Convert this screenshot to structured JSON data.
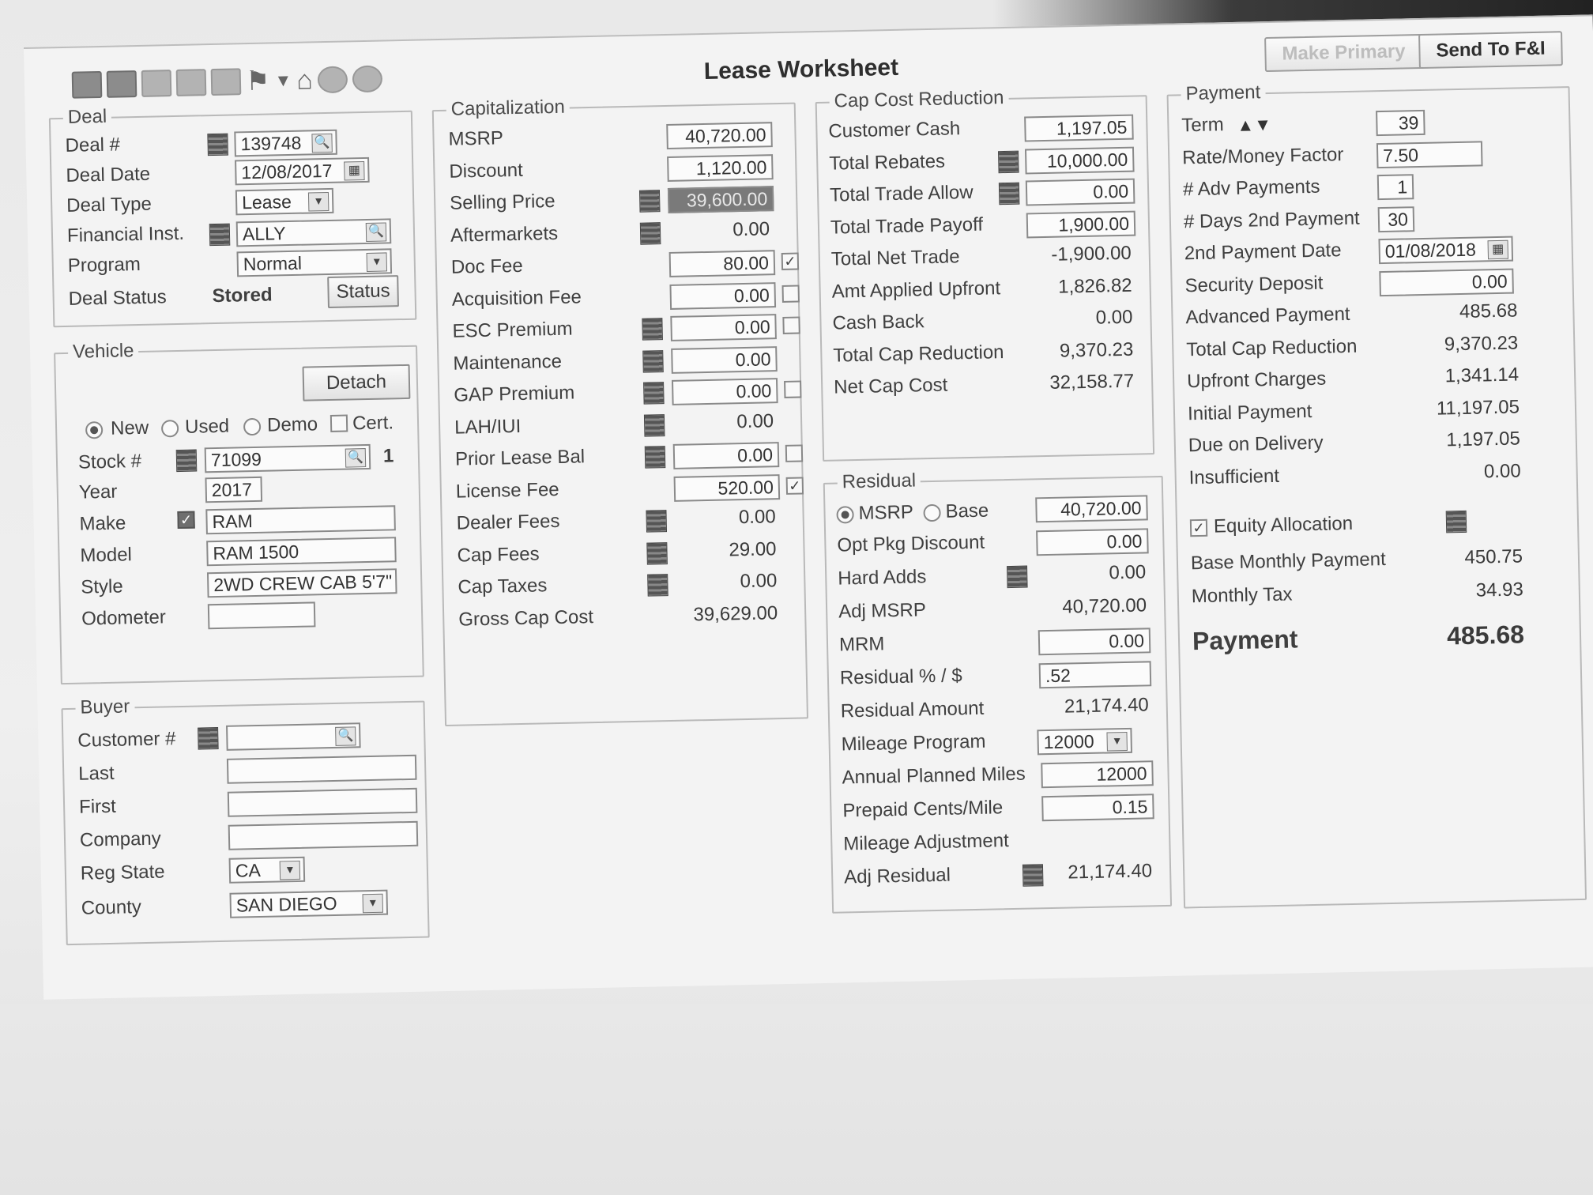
{
  "window": {
    "title": "Lease Worksheet",
    "make_primary": "Make Primary",
    "send_to_fi": "Send To F&I"
  },
  "deal": {
    "legend": "Deal",
    "deal_no_label": "Deal #",
    "deal_no": "139748",
    "deal_date_label": "Deal Date",
    "deal_date": "12/08/2017",
    "deal_type_label": "Deal Type",
    "deal_type": "Lease",
    "financial_label": "Financial Inst.",
    "financial": "ALLY",
    "program_label": "Program",
    "program": "Normal",
    "status_label": "Deal Status",
    "status": "Stored",
    "status_button": "Status"
  },
  "vehicle": {
    "legend": "Vehicle",
    "detach": "Detach",
    "new": "New",
    "used": "Used",
    "demo": "Demo",
    "cert": "Cert.",
    "stock_label": "Stock #",
    "stock": "71099",
    "stock_count": "1",
    "year_label": "Year",
    "year": "2017",
    "make_label": "Make",
    "make": "RAM",
    "model_label": "Model",
    "model": "RAM 1500",
    "style_label": "Style",
    "style": "2WD CREW CAB 5'7\"",
    "odometer_label": "Odometer",
    "odometer": ""
  },
  "buyer": {
    "legend": "Buyer",
    "customer_label": "Customer #",
    "last_label": "Last",
    "first_label": "First",
    "company_label": "Company",
    "reg_state_label": "Reg State",
    "reg_state": "CA",
    "county_label": "County",
    "county": "SAN DIEGO"
  },
  "capitalization": {
    "legend": "Capitalization",
    "rows": [
      {
        "label": "MSRP",
        "value": "40,720.00"
      },
      {
        "label": "Discount",
        "value": "1,120.00"
      },
      {
        "label": "Selling Price",
        "value": "39,600.00"
      },
      {
        "label": "Aftermarkets",
        "value": "0.00"
      },
      {
        "label": "Doc Fee",
        "value": "80.00"
      },
      {
        "label": "Acquisition Fee",
        "value": "0.00"
      },
      {
        "label": "ESC Premium",
        "value": "0.00"
      },
      {
        "label": "Maintenance",
        "value": "0.00"
      },
      {
        "label": "GAP Premium",
        "value": "0.00"
      },
      {
        "label": "LAH/IUI",
        "value": "0.00"
      },
      {
        "label": "Prior Lease Bal",
        "value": "0.00"
      },
      {
        "label": "License Fee",
        "value": "520.00"
      },
      {
        "label": "Dealer Fees",
        "value": "0.00"
      },
      {
        "label": "Cap Fees",
        "value": "29.00"
      },
      {
        "label": "Cap Taxes",
        "value": "0.00"
      },
      {
        "label": "Gross Cap Cost",
        "value": "39,629.00"
      }
    ]
  },
  "cap_reduction": {
    "legend": "Cap Cost Reduction",
    "rows": [
      {
        "label": "Customer Cash",
        "value": "1,197.05"
      },
      {
        "label": "Total Rebates",
        "value": "10,000.00"
      },
      {
        "label": "Total Trade Allow",
        "value": "0.00"
      },
      {
        "label": "Total Trade Payoff",
        "value": "1,900.00"
      },
      {
        "label": "Total Net Trade",
        "value": "-1,900.00"
      },
      {
        "label": "Amt Applied Upfront",
        "value": "1,826.82"
      },
      {
        "label": "Cash Back",
        "value": "0.00"
      },
      {
        "label": "Total Cap Reduction",
        "value": "9,370.23"
      },
      {
        "label": "Net Cap Cost",
        "value": "32,158.77"
      }
    ]
  },
  "residual": {
    "legend": "Residual",
    "msrp_radio": "MSRP",
    "base_radio": "Base",
    "base_value": "40,720.00",
    "rows": [
      {
        "label": "Opt Pkg Discount",
        "value": "0.00"
      },
      {
        "label": "Hard Adds",
        "value": "0.00"
      },
      {
        "label": "Adj MSRP",
        "value": "40,720.00"
      },
      {
        "label": "MRM",
        "value": "0.00"
      },
      {
        "label": "Residual % / $",
        "value": ".52"
      },
      {
        "label": "Residual Amount",
        "value": "21,174.40"
      },
      {
        "label": "Mileage Program",
        "value": "12000"
      },
      {
        "label": "Annual Planned Miles",
        "value": "12000"
      },
      {
        "label": "Prepaid Cents/Mile",
        "value": "0.15"
      },
      {
        "label": "Mileage Adjustment",
        "value": ""
      },
      {
        "label": "Adj Residual",
        "value": "21,174.40"
      }
    ]
  },
  "payment": {
    "legend": "Payment",
    "rows": [
      {
        "label": "Term",
        "value": "39"
      },
      {
        "label": "Rate/Money Factor",
        "value": "7.50"
      },
      {
        "label": "# Adv Payments",
        "value": "1"
      },
      {
        "label": "# Days 2nd Payment",
        "value": "30"
      },
      {
        "label": "2nd Payment Date",
        "value": "01/08/2018"
      },
      {
        "label": "Security Deposit",
        "value": "0.00"
      },
      {
        "label": "Advanced Payment",
        "value": "485.68"
      },
      {
        "label": "Total Cap Reduction",
        "value": "9,370.23"
      },
      {
        "label": "Upfront Charges",
        "value": "1,341.14"
      },
      {
        "label": "Initial Payment",
        "value": "11,197.05"
      },
      {
        "label": "Due on Delivery",
        "value": "1,197.05"
      },
      {
        "label": "Insufficient",
        "value": "0.00"
      }
    ],
    "equity_allocation": "Equity Allocation",
    "base_monthly_label": "Base Monthly Payment",
    "base_monthly": "450.75",
    "monthly_tax_label": "Monthly Tax",
    "monthly_tax": "34.93",
    "payment_label": "Payment",
    "payment": "485.68"
  }
}
